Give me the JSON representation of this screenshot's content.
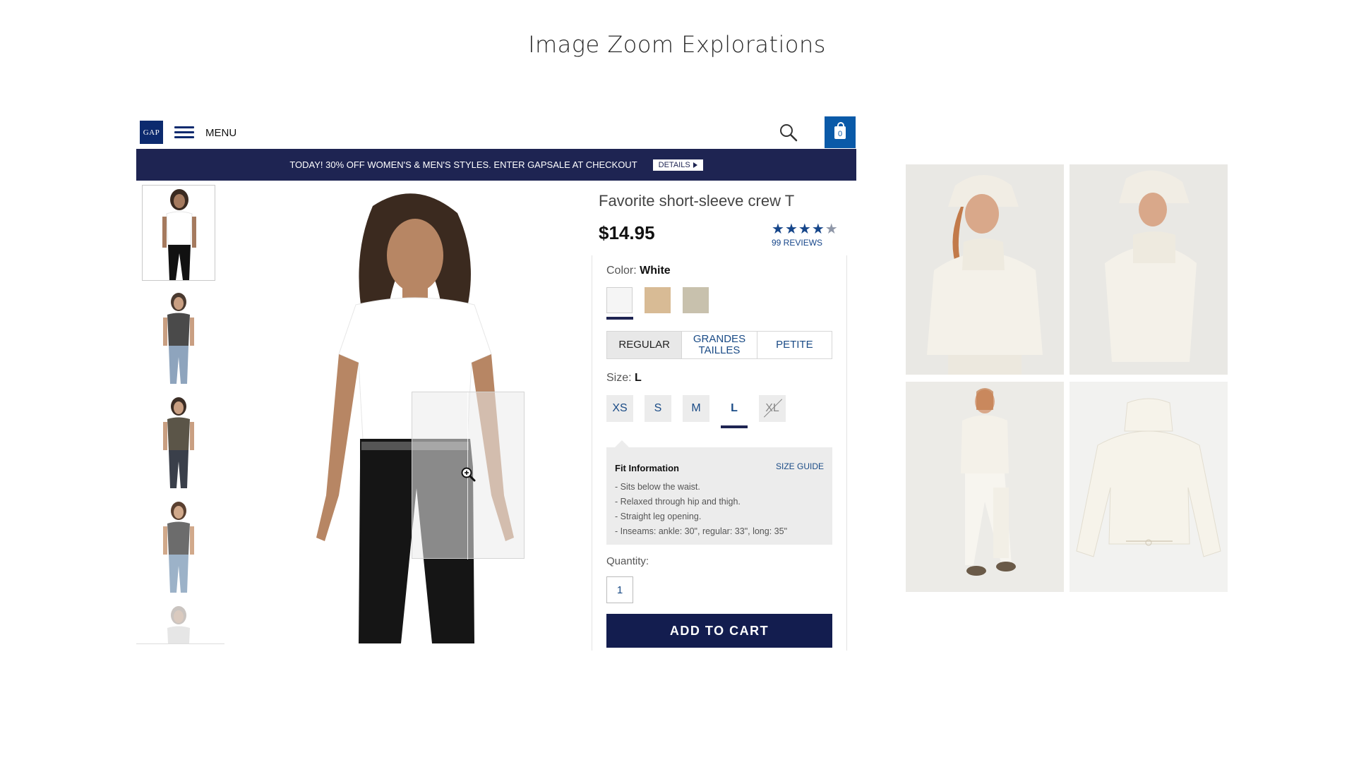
{
  "page_title": "Image Zoom Explorations",
  "header": {
    "logo_text": "GAP",
    "menu_label": "MENU",
    "bag_count": "0"
  },
  "promo": {
    "text": "TODAY! 30% OFF WOMEN'S & MEN'S STYLES. ENTER GAPSALE AT CHECKOUT",
    "details_label": "DETAILS"
  },
  "product": {
    "title": "Favorite short-sleeve crew T",
    "price": "$14.95",
    "rating_stars": 4,
    "reviews_label": "99 REVIEWS"
  },
  "color": {
    "label": "Color:",
    "selected": "White",
    "swatches": [
      "#f5f5f5",
      "#d8bb95",
      "#c8c1ad"
    ]
  },
  "fit_tabs": [
    "REGULAR",
    "GRANDES TAILLES",
    "PETITE"
  ],
  "size": {
    "label": "Size:",
    "selected": "L",
    "options": [
      "XS",
      "S",
      "M",
      "L",
      "XL"
    ]
  },
  "fit_info": {
    "title": "Fit Information",
    "guide_label": "SIZE GUIDE",
    "items": [
      "- Sits below the waist.",
      "- Relaxed through hip and thigh.",
      "- Straight leg opening.",
      "- Inseams: ankle: 30\", regular: 33\", long: 35\""
    ]
  },
  "quantity": {
    "label": "Quantity:",
    "value": "1"
  },
  "cart_button": "ADD TO CART",
  "colors": {
    "navy": "#1e2452",
    "link_blue": "#1a4b86",
    "bag_blue": "#0a5aa8"
  }
}
